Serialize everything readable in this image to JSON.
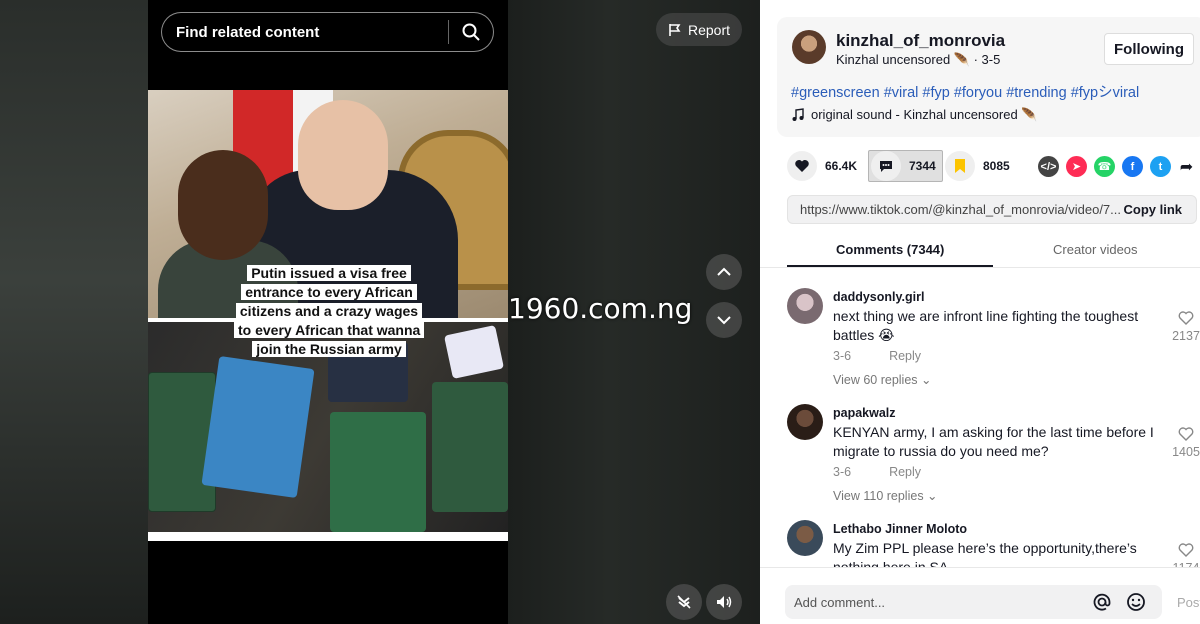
{
  "search": {
    "placeholder": "Find related content"
  },
  "report": {
    "label": "Report"
  },
  "video": {
    "caption": "Putin issued a visa free entrance to every African citizens and a crazy wages to every African that wanna join the Russian army",
    "watermark": "1960.com.ng"
  },
  "author": {
    "username": "kinzhal_of_monrovia",
    "display": "Kinzhal uncensored 🪶 · 3-5",
    "follow_label": "Following"
  },
  "description": {
    "hashtags": "#greenscreen #viral #fyp #foryou #trending #fypシviral",
    "sound": "original sound - Kinzhal uncensored 🪶"
  },
  "actions": {
    "likes": "66.4K",
    "comments": "7344",
    "saves": "8085"
  },
  "share_colors": {
    "embed": "#444444",
    "send": "#fe2c55",
    "whatsapp": "#25d366",
    "facebook": "#1877f2",
    "twitter": "#1da1f2"
  },
  "link": {
    "url": "https://www.tiktok.com/@kinzhal_of_monrovia/video/7...",
    "copy_label": "Copy link"
  },
  "tabs": {
    "comments": "Comments (7344)",
    "creator": "Creator videos"
  },
  "comments": [
    {
      "user": "daddysonly.girl",
      "text": "next thing we are infront line fighting the toughest battles 😭",
      "date": "3-6",
      "reply": "Reply",
      "views": "View 60 replies",
      "likes": "2137"
    },
    {
      "user": "papakwalz",
      "text": "KENYAN army, I am asking for the last time before I migrate to russia do you need me?",
      "date": "3-6",
      "reply": "Reply",
      "views": "View 110 replies",
      "likes": "1405"
    },
    {
      "user": "Lethabo Jinner Moloto",
      "text": "My Zim PPL please here’s the opportunity,there’s nothing here in SA",
      "likes": "1174"
    }
  ],
  "composer": {
    "placeholder": "Add comment...",
    "post_label": "Post"
  }
}
